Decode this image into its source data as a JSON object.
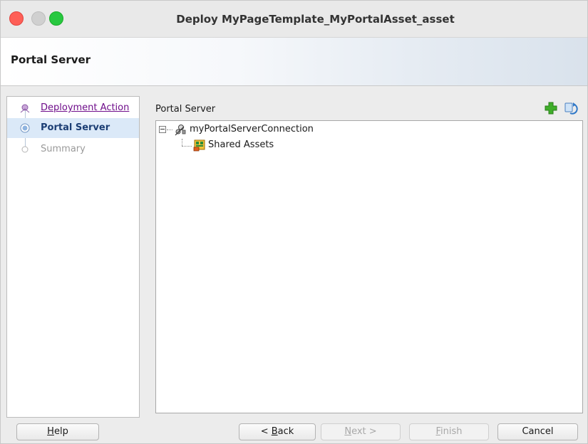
{
  "window": {
    "title": "Deploy MyPageTemplate_MyPortalAsset_asset"
  },
  "header": {
    "title": "Portal Server"
  },
  "steps": [
    {
      "label": "Deployment Action",
      "state": "visited"
    },
    {
      "label": "Portal Server",
      "state": "current"
    },
    {
      "label": "Summary",
      "state": "disabled"
    }
  ],
  "panel": {
    "label": "Portal Server",
    "tools": {
      "add_icon": "green-plus-icon",
      "refresh_icon": "refresh-icon"
    }
  },
  "tree": {
    "root": {
      "label": "myPortalServerConnection",
      "icon": "connection-icon",
      "expanded": true
    },
    "children": [
      {
        "label": "Shared Assets",
        "icon": "shared-assets-icon"
      }
    ]
  },
  "buttons": {
    "help_prefix": "",
    "help_mnemonic": "H",
    "help_rest": "elp",
    "back_prefix": "< ",
    "back_mnemonic": "B",
    "back_rest": "ack",
    "next_mnemonic": "N",
    "next_rest": "ext >",
    "finish_mnemonic": "F",
    "finish_rest": "inish",
    "cancel": "Cancel"
  },
  "colors": {
    "close": "#fe5f57",
    "maximize": "#28c840",
    "link_visited": "#6e0c8a",
    "current_step": "#1c3e74",
    "selection": "#dbe9f8"
  }
}
